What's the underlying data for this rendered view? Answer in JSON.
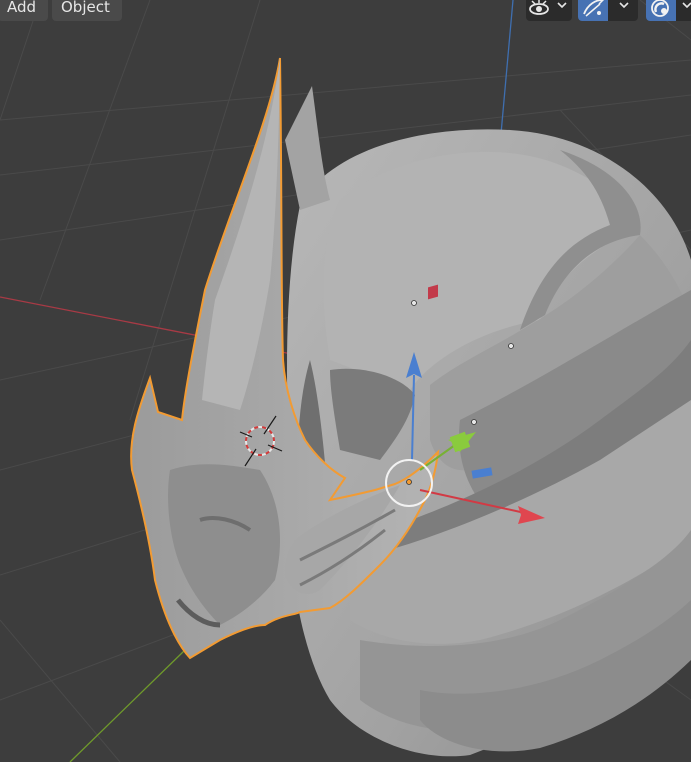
{
  "header": {
    "menu_add": "Add",
    "menu_object": "Object"
  },
  "toolbar": {
    "visibility_icon": "eye-icon",
    "gizmo_icon": "gizmo-icon",
    "overlay_icon": "overlay-icon",
    "accent_color": "#4772b3"
  },
  "viewport": {
    "background_color": "#3d3d3d",
    "grid_color": "#4a4a4a",
    "x_axis_color": "#a83a45",
    "y_axis_color": "#6f9a2b",
    "z_axis_color": "#3f6fb0",
    "selection_outline_color": "#f29b33",
    "model_color": "#a9a9a9"
  }
}
